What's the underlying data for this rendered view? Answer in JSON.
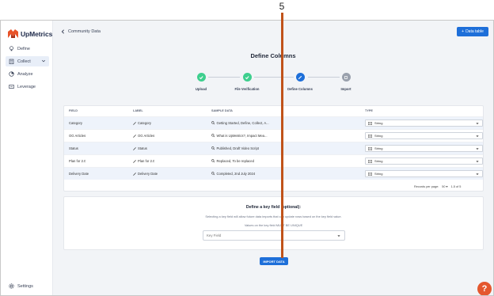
{
  "annotation": {
    "step_number": "5"
  },
  "app": {
    "brand": "UpMetrics"
  },
  "sidebar": {
    "items": [
      {
        "label": "Define",
        "icon": "lightbulb-icon"
      },
      {
        "label": "Collect",
        "icon": "clipboard-icon"
      },
      {
        "label": "Analyze",
        "icon": "chart-icon"
      },
      {
        "label": "Leverage",
        "icon": "share-icon"
      }
    ],
    "settings": "Settings"
  },
  "header": {
    "back_label": "Community Data",
    "data_table_button": "Data table"
  },
  "page": {
    "title": "Define Columns"
  },
  "steps": [
    {
      "label": "Upload",
      "status": "complete"
    },
    {
      "label": "File Verification",
      "status": "complete"
    },
    {
      "label": "Define Columns",
      "status": "active"
    },
    {
      "label": "Import",
      "status": "pending"
    }
  ],
  "table": {
    "headers": {
      "field": "FIELD",
      "label": "LABEL",
      "sample": "SAMPLE DATA",
      "type": "TYPE"
    },
    "rows": [
      {
        "field": "Category",
        "label": "Category",
        "sample": "Getting Started, Define, Collect, A...",
        "type": "String"
      },
      {
        "field": "OG Articles",
        "label": "OG Articles",
        "sample": "What is UpMetrics?, Impact Mea...",
        "type": "String"
      },
      {
        "field": "Status",
        "label": "Status",
        "sample": "Published, Draft Video Script",
        "type": "String"
      },
      {
        "field": "Plan for 2.0",
        "label": "Plan for 2.0",
        "sample": "Replaced, To be replaced",
        "type": "String"
      },
      {
        "field": "Delivery Date",
        "label": "Delivery Date",
        "sample": "Completed, 2nd July 2024",
        "type": "String"
      }
    ],
    "pager": {
      "records_label": "Records per page:",
      "per_page": "50",
      "range": "1-5 of 5"
    }
  },
  "key_field": {
    "title": "Define a key field (optional):",
    "description": "Selecting a key field will allow future data imports that can update rows based on the key field value.",
    "note": "Values on the key field MUST BE UNIQUE",
    "placeholder": "Key Field"
  },
  "import_button": "IMPORT DATA",
  "help": "?",
  "colors": {
    "primary": "#1e6fd9",
    "success": "#3ecf8e",
    "annotation": "#c0531a",
    "help": "#e4572e",
    "brand_orange": "#e8542a"
  }
}
